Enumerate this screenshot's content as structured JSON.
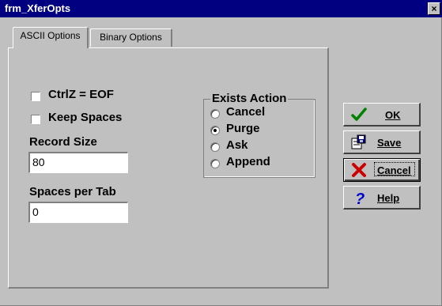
{
  "window": {
    "title": "frm_XferOpts",
    "close_glyph": "×"
  },
  "tabs": [
    {
      "label": "ASCII Options",
      "active": true
    },
    {
      "label": "Binary Options",
      "active": false
    }
  ],
  "ascii": {
    "ctrlz_label": "CtrlZ = EOF",
    "ctrlz_checked": false,
    "keep_spaces_label": "Keep Spaces",
    "keep_spaces_checked": false,
    "record_size_label": "Record Size",
    "record_size_value": "80",
    "spaces_per_tab_label": "Spaces per Tab",
    "spaces_per_tab_value": "0"
  },
  "exists_action": {
    "legend": "Exists Action",
    "options": [
      {
        "label": "Cancel",
        "selected": false
      },
      {
        "label": "Purge",
        "selected": true
      },
      {
        "label": "Ask",
        "selected": false
      },
      {
        "label": "Append",
        "selected": false
      }
    ]
  },
  "buttons": {
    "ok": {
      "label": "OK",
      "icon": "checkmark-icon"
    },
    "save": {
      "label": "Save",
      "icon": "save-icon"
    },
    "cancel": {
      "label": "Cancel",
      "icon": "x-cancel-icon"
    },
    "help": {
      "label": "Help",
      "icon": "question-icon"
    }
  },
  "colors": {
    "titlebar": "#000080",
    "face": "#c0c0c0",
    "ok_check": "#008000",
    "cancel_x": "#cc0000",
    "help_q": "#0000cc"
  }
}
